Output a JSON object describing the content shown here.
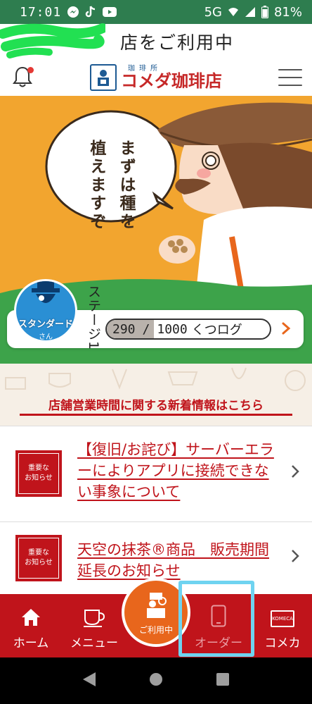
{
  "status_bar": {
    "time": "17:01",
    "network": "5G",
    "battery": "81%"
  },
  "banner": {
    "using_store_text": "店をご利用中"
  },
  "header": {
    "logo_sub": "珈琲所",
    "logo_main": "コメダ珈琲店"
  },
  "hero": {
    "speech_lines": [
      "まずは種を",
      "植えますぞ"
    ]
  },
  "stage": {
    "badge_label": "スタンダード",
    "badge_sub": "さん",
    "stage_label": "ステージ1",
    "points_current": "290",
    "points_separator": "/",
    "points_goal": "1000",
    "points_unit": "くつログ",
    "progress_fraction": 0.29
  },
  "news": {
    "banner_text": "店舗営業時間に関する新着情報はこちら"
  },
  "notices": [
    {
      "badge_line1": "重要な",
      "badge_line2": "お知らせ",
      "title": "【復旧/お詫び】サーバーエラーによりアプリに接続できない事象について"
    },
    {
      "badge_line1": "重要な",
      "badge_line2": "お知らせ",
      "title": "天空の抹茶®商品　販売期間延長のお知らせ"
    }
  ],
  "bottom_nav": {
    "home": "ホーム",
    "menu": "メニュー",
    "center": "ご利用中",
    "order": "オーダー",
    "komeca": "コメカ",
    "komeca_card_text": "KOMECA"
  },
  "colors": {
    "brand_red": "#c0141b",
    "hero_orange": "#f2a52f",
    "accent_orange": "#e8661c",
    "highlight_cyan": "#6fd3f0"
  }
}
